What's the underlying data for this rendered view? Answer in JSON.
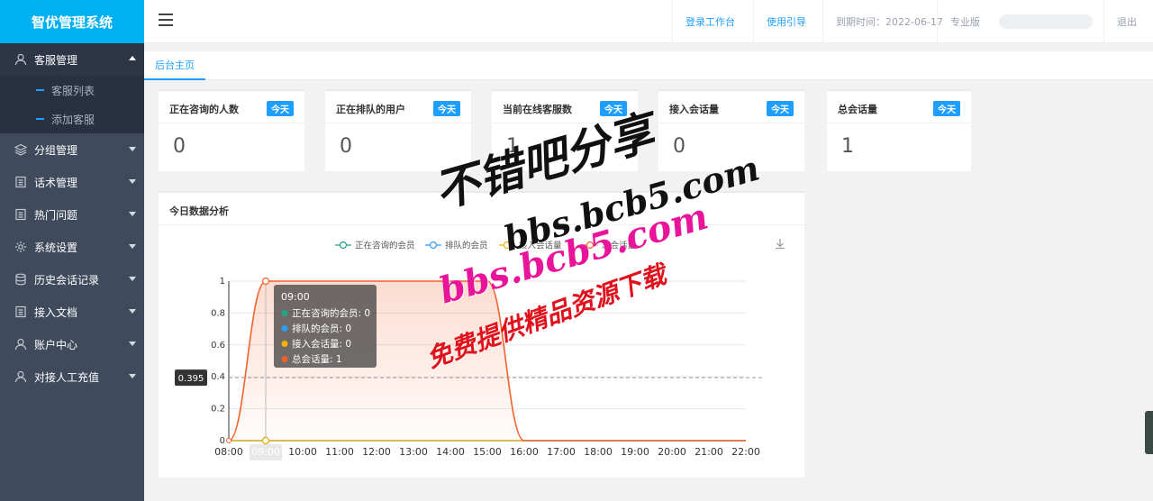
{
  "app": {
    "title": "智优管理系统"
  },
  "sidebar": {
    "items": [
      {
        "label": "客服管理",
        "icon": "user-icon",
        "open": true,
        "children": [
          {
            "label": "客服列表"
          },
          {
            "label": "添加客服"
          }
        ]
      },
      {
        "label": "分组管理",
        "icon": "layers-icon"
      },
      {
        "label": "话术管理",
        "icon": "document-icon"
      },
      {
        "label": "热门问题",
        "icon": "document-icon"
      },
      {
        "label": "系统设置",
        "icon": "gear-icon"
      },
      {
        "label": "历史会话记录",
        "icon": "database-icon"
      },
      {
        "label": "接入文档",
        "icon": "document-icon"
      },
      {
        "label": "账户中心",
        "icon": "user-icon"
      },
      {
        "label": "对接人工充值",
        "icon": "user-icon"
      }
    ]
  },
  "header": {
    "workbench": "登录工作台",
    "guide": "使用引导",
    "expiry": "到期时间：2022-06-17",
    "edition": "专业版",
    "logout": "退出"
  },
  "tabs": [
    {
      "label": "后台主页"
    }
  ],
  "stats": [
    {
      "title": "正在咨询的人数",
      "badge": "今天",
      "value": "0"
    },
    {
      "title": "正在排队的用户",
      "badge": "今天",
      "value": "0"
    },
    {
      "title": "当前在线客服数",
      "badge": "今天",
      "value": "1"
    },
    {
      "title": "接入会话量",
      "badge": "今天",
      "value": "0"
    },
    {
      "title": "总会话量",
      "badge": "今天",
      "value": "1"
    }
  ],
  "analysis": {
    "title": "今日数据分析",
    "axis_pointer_value": "0.395",
    "tooltip": {
      "time": "09:00",
      "lines": [
        "正在咨询的会员: 0",
        "排队的会员: 0",
        "接入会话量: 0",
        "总会话量: 1"
      ]
    }
  },
  "watermark": {
    "line1": "不错吧分享",
    "line2": "bbs.bcb5.com",
    "line3": "bbs.bcb5.com",
    "line4": "免费提供精品资源下载"
  },
  "colors": {
    "brand": "#01b0f1",
    "accent": "#1e9fff",
    "series": [
      "#20a48a",
      "#2f9bf5",
      "#f7b100",
      "#f2622c"
    ]
  },
  "chart_data": {
    "type": "line",
    "x": [
      "08:00",
      "09:00",
      "10:00",
      "11:00",
      "12:00",
      "13:00",
      "14:00",
      "15:00",
      "16:00",
      "17:00",
      "18:00",
      "19:00",
      "20:00",
      "21:00",
      "22:00"
    ],
    "series": [
      {
        "name": "正在咨询的会员",
        "values": [
          0,
          0,
          0,
          0,
          0,
          0,
          0,
          0,
          0,
          0,
          0,
          0,
          0,
          0,
          0
        ]
      },
      {
        "name": "排队的会员",
        "values": [
          0,
          0,
          0,
          0,
          0,
          0,
          0,
          0,
          0,
          0,
          0,
          0,
          0,
          0,
          0
        ]
      },
      {
        "name": "接入会话量",
        "values": [
          0,
          0,
          0,
          0,
          0,
          0,
          0,
          0,
          0,
          0,
          0,
          0,
          0,
          0,
          0
        ]
      },
      {
        "name": "总会话量",
        "values": [
          0,
          1,
          1,
          1,
          1,
          1,
          1,
          1,
          0,
          0,
          0,
          0,
          0,
          0,
          0
        ]
      }
    ],
    "yticks": [
      "0",
      "0.2",
      "0.4",
      "0.6",
      "0.8",
      "1"
    ],
    "ylim": [
      0,
      1
    ],
    "grid": true,
    "legend": "top-center",
    "highlighted_x": "09:00"
  }
}
